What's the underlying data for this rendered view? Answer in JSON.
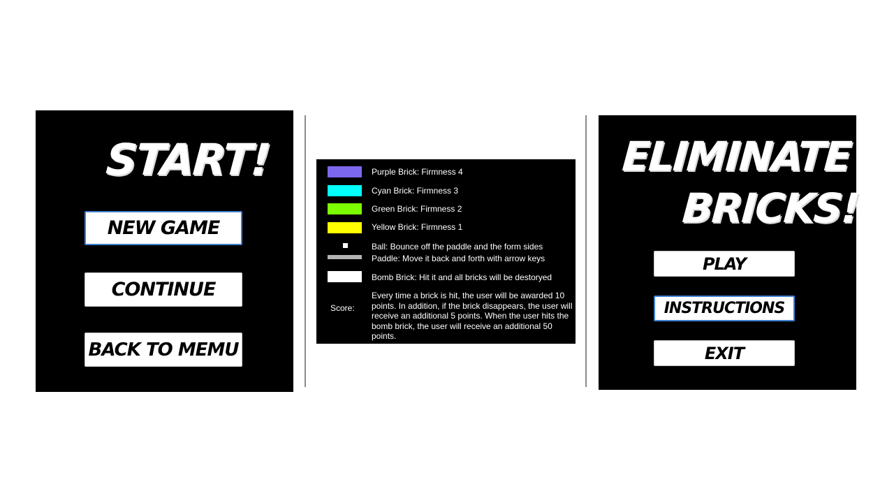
{
  "start_screen": {
    "title": "START!",
    "buttons": {
      "new_game": "NEW GAME",
      "continue": "CONTINUE",
      "back_to_menu": "BACK TO MEMU"
    }
  },
  "instructions_screen": {
    "legend": [
      {
        "label": "Purple Brick: Firmness 4",
        "color": "#7b68ee"
      },
      {
        "label": "Cyan Brick: Firmness 3",
        "color": "#00ffff"
      },
      {
        "label": "Green Brick: Firmness 2",
        "color": "#7cfc00"
      },
      {
        "label": "Yellow Brick: Firmness 1",
        "color": "#ffff00"
      }
    ],
    "ball_label": "Ball: Bounce off the paddle and the form sides",
    "paddle_label": "Paddle: Move it back and forth with arrow keys",
    "bomb_label": "Bomb Brick: Hit it and all bricks will be destoryed",
    "score_label": "Score:",
    "score_description": "Every time a brick is hit, the user will be awarded 10 points. In addition, if the brick disappears, the user will receive an additional 5 points. When the user hits the bomb brick, the user will receive an additional 50 points."
  },
  "title_screen": {
    "title_line_1": "ELIMINATE",
    "title_line_2": "BRICKS!",
    "buttons": {
      "play": "PLAY",
      "instructions": "INSTRUCTIONS",
      "exit": "EXIT"
    }
  },
  "colors": {
    "panel_background": "#000000",
    "button_background": "#ffffff",
    "focus_border": "#3c7fd0",
    "divider": "#8a8a8a"
  }
}
